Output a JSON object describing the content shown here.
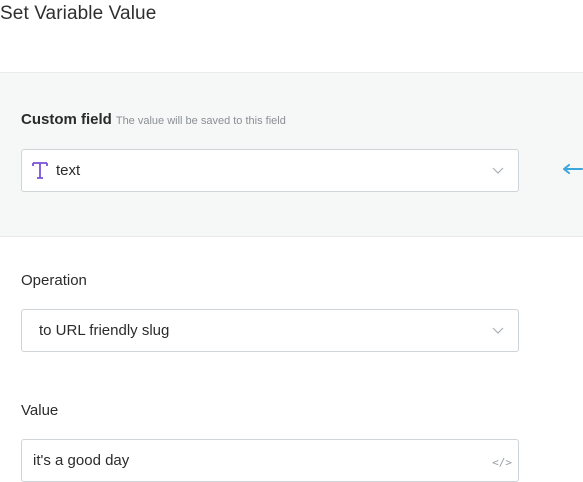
{
  "dialog": {
    "title": "Set Variable Value"
  },
  "custom_field": {
    "label": "Custom field",
    "hint": "The value will be saved to this field",
    "selected_value": "text",
    "type_icon": "text-type-icon"
  },
  "operation": {
    "label": "Operation",
    "selected_value": "to URL friendly slug"
  },
  "value": {
    "label": "Value",
    "current_value": "it's a good day"
  },
  "colors": {
    "accent_arrow": "#3aa6dc",
    "type_icon": "#7b52d9"
  }
}
